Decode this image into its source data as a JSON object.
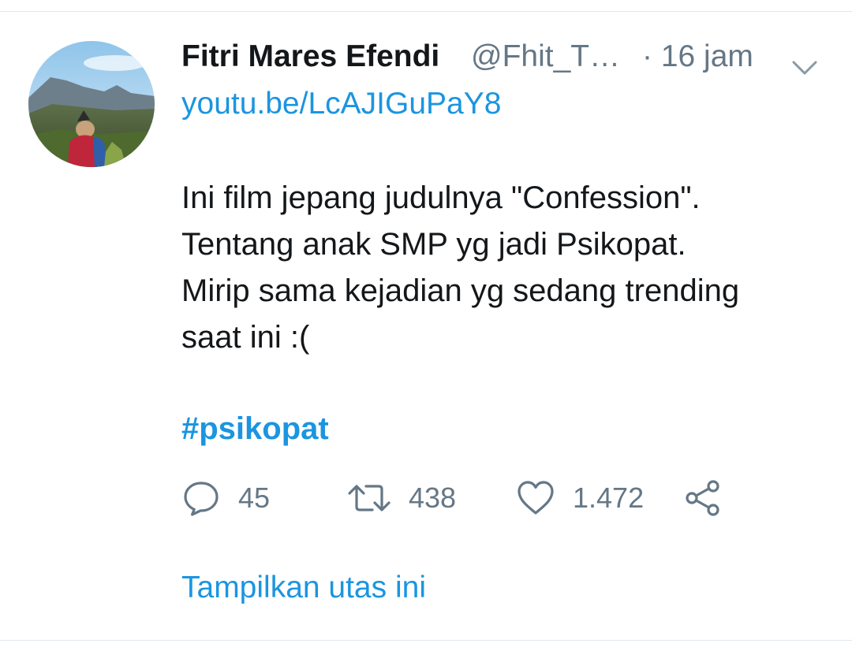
{
  "tweet": {
    "author": {
      "display_name": "Fitri Mares Efendi",
      "handle": "@Fhit_T…"
    },
    "timestamp": "· 16 jam",
    "link": "youtu.be/LcAJIGuPaY8",
    "text_lines": [
      "Ini film jepang judulnya \"Confession\".",
      "Tentang anak SMP yg jadi Psikopat.",
      "Mirip sama kejadian yg sedang trending",
      "saat ini :("
    ],
    "hashtag": "#psikopat",
    "actions": {
      "replies": "45",
      "retweets": "438",
      "likes": "1.472"
    },
    "show_thread_label": "Tampilkan utas ini"
  },
  "icons": {
    "reply": "reply-icon",
    "retweet": "retweet-icon",
    "like": "heart-icon",
    "share": "share-icon",
    "more": "chevron-down-icon"
  },
  "colors": {
    "link_blue": "#1b95e0",
    "secondary_gray": "#657786",
    "text_dark": "#14171a",
    "divider": "#e1e8ed"
  }
}
